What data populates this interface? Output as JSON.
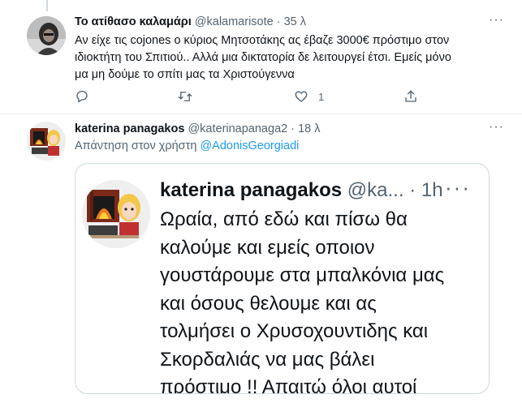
{
  "tweet1": {
    "display_name": "Το ατίθασο καλαμάρι",
    "handle": "@kalamarisote",
    "separator": "·",
    "time": "35 λ",
    "more": "···",
    "text_lines": [
      "Αν είχε τις cojones ο κύριος Μητσοτάκης ας έβαζε 3000€ πρόστιμο στον",
      "ιδιοκτήτη του Σπιτιού..   Αλλά μια δικτατορία δε λειτουργεί έτσι. Εμείς μόνο",
      "μα μη δούμε το σπίτι μας τα Χριστούγεννα"
    ],
    "actions": {
      "reply_icon": "reply-icon",
      "retweet_icon": "retweet-icon",
      "like_icon": "heart-icon",
      "like_count": "1",
      "share_icon": "share-icon"
    }
  },
  "tweet2": {
    "display_name": "katerina panagakos",
    "handle": "@katerinapanaga2",
    "separator": "·",
    "time": "18 λ",
    "more": "···",
    "reply_prefix": "Απάντηση στον χρήστη",
    "reply_mention": "@AdonisGeorgiadi",
    "embed": {
      "display_name": "katerina panagakos",
      "handle": "@ka...",
      "separator": "·",
      "time": "1h",
      "more": "···",
      "text_lines": [
        "Ωραία, από εδώ και πίσω θα",
        "καλούμε και εμείς οποιον",
        "γουστάρουμε στα μπαλκόνια μας",
        "και όσους θελουμε και ας",
        "τολμήσει ο Χρυσοχουντιδης και",
        "Σκορδαλιάς να μας βάλει",
        "πρόστιμο !! Απαιτώ όλοι αυτοί"
      ]
    }
  },
  "colors": {
    "accent": "#1d9bf0",
    "muted": "#536471",
    "border": "#cfd9de"
  }
}
